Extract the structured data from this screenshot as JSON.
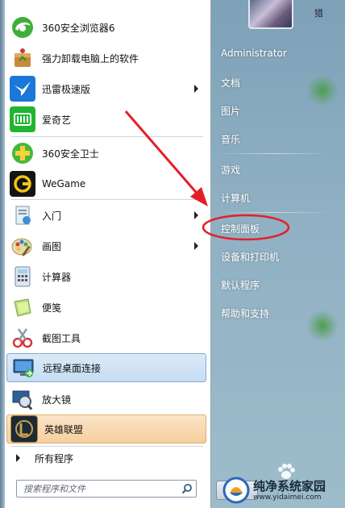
{
  "start_menu": {
    "pinned": [
      {
        "label": "360安全浏览器6",
        "icon": "browser-360-icon",
        "has_submenu": false
      },
      {
        "label": "强力卸载电脑上的软件",
        "icon": "uninstall-box-icon",
        "has_submenu": false
      },
      {
        "label": "迅雷极速版",
        "icon": "xunlei-bird-icon",
        "has_submenu": true
      },
      {
        "label": "爱奇艺",
        "icon": "iqiyi-icon",
        "has_submenu": false
      },
      {
        "label": "360安全卫士",
        "icon": "security-360-icon",
        "has_submenu": false
      },
      {
        "label": "WeGame",
        "icon": "wegame-icon",
        "has_submenu": false
      },
      {
        "label": "入门",
        "icon": "getting-started-icon",
        "has_submenu": true
      },
      {
        "label": "画图",
        "icon": "paint-icon",
        "has_submenu": true
      },
      {
        "label": "计算器",
        "icon": "calculator-icon",
        "has_submenu": false
      },
      {
        "label": "便笺",
        "icon": "sticky-notes-icon",
        "has_submenu": false
      },
      {
        "label": "截图工具",
        "icon": "snipping-tool-icon",
        "has_submenu": false
      },
      {
        "label": "远程桌面连接",
        "icon": "remote-desktop-icon",
        "has_submenu": false
      },
      {
        "label": "放大镜",
        "icon": "magnifier-icon",
        "has_submenu": false
      },
      {
        "label": "英雄联盟",
        "icon": "league-of-legends-icon",
        "has_submenu": false
      }
    ],
    "all_programs": "所有程序",
    "search_placeholder": "搜索程序和文件",
    "right_items": [
      {
        "label": "Administrator"
      },
      {
        "label": "文档"
      },
      {
        "label": "图片"
      },
      {
        "label": "音乐"
      },
      {
        "label": "游戏"
      },
      {
        "label": "计算机"
      },
      {
        "label": "控制面板"
      },
      {
        "label": "设备和打印机"
      },
      {
        "label": "默认程序"
      },
      {
        "label": "帮助和支持"
      }
    ],
    "top_title": "猎"
  },
  "watermark": {
    "title": "纯净系统家园",
    "url": "www.yidaimei.com"
  },
  "annotation_colors": {
    "arrow": "#e3202a",
    "ellipse": "#e3202a"
  }
}
